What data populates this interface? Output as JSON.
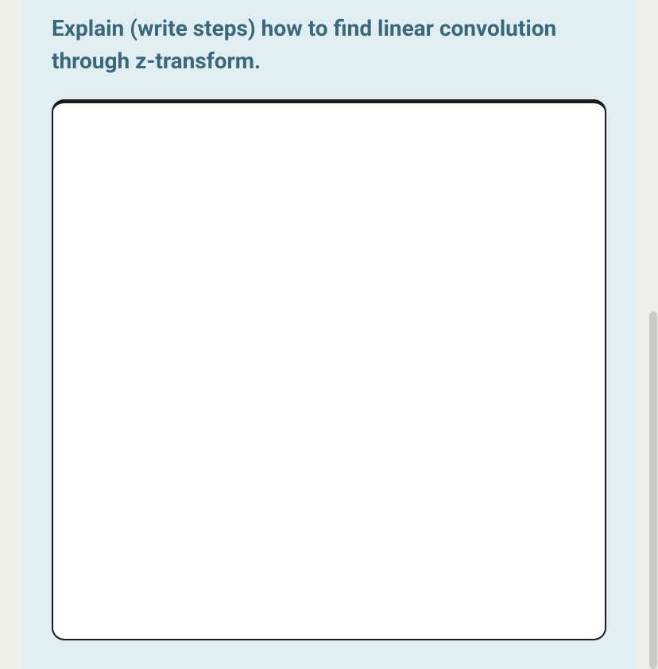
{
  "question": {
    "prompt": "Explain (write steps) how to find linear convolution through z-transform."
  },
  "answer": {
    "value": ""
  }
}
